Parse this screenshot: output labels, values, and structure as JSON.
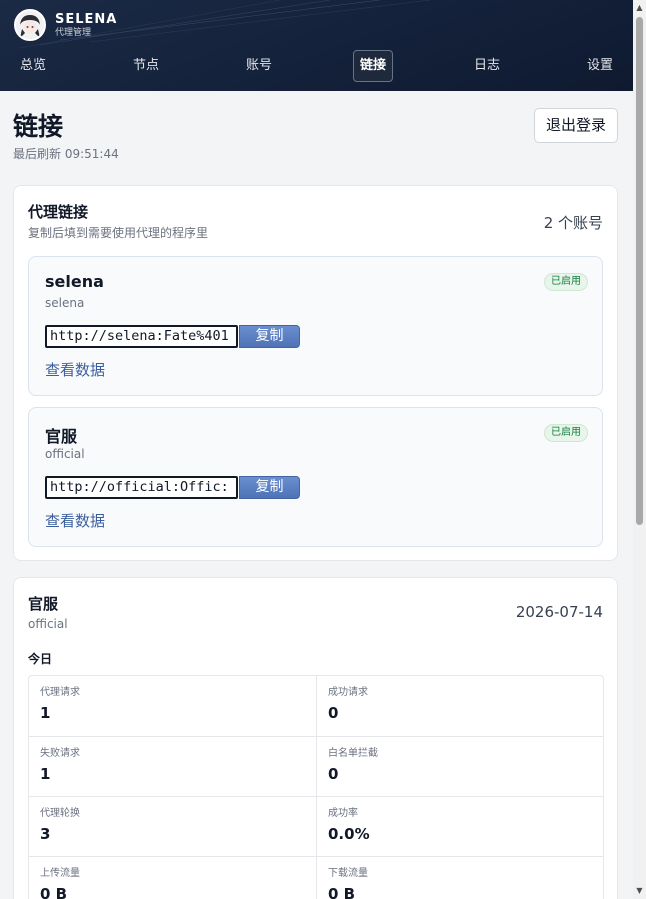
{
  "brand": {
    "name": "SELENA",
    "subtitle": "代理管理"
  },
  "nav": [
    {
      "label": "总览",
      "active": false
    },
    {
      "label": "节点",
      "active": false
    },
    {
      "label": "账号",
      "active": false
    },
    {
      "label": "链接",
      "active": true
    },
    {
      "label": "日志",
      "active": false
    },
    {
      "label": "设置",
      "active": false
    }
  ],
  "page": {
    "title": "链接",
    "last_refresh": "最后刷新 09:51:44",
    "logout_label": "退出登录"
  },
  "proxy_links": {
    "title": "代理链接",
    "subtitle": "复制后填到需要使用代理的程序里",
    "account_count": "2 个账号",
    "accounts": [
      {
        "name": "selena",
        "id": "selena",
        "status": "已启用",
        "url": "http://selena:Fate%401",
        "copy_label": "复制",
        "view_label": "查看数据"
      },
      {
        "name": "官服",
        "id": "official",
        "status": "已启用",
        "url": "http://official:Offic:",
        "copy_label": "复制",
        "view_label": "查看数据"
      }
    ]
  },
  "stats": {
    "title": "官服",
    "id": "official",
    "date": "2026-07-14",
    "period": "今日",
    "rows": [
      [
        {
          "label": "代理请求",
          "value": "1"
        },
        {
          "label": "成功请求",
          "value": "0"
        }
      ],
      [
        {
          "label": "失败请求",
          "value": "1"
        },
        {
          "label": "白名单拦截",
          "value": "0"
        }
      ],
      [
        {
          "label": "代理轮换",
          "value": "3"
        },
        {
          "label": "成功率",
          "value": "0.0%"
        }
      ],
      [
        {
          "label": "上传流量",
          "value": "0 B"
        },
        {
          "label": "下载流量",
          "value": "0 B"
        }
      ]
    ]
  },
  "colors": {
    "header_bg": "#14213a",
    "accent": "#4e72b6",
    "status_green": "#15803d"
  }
}
